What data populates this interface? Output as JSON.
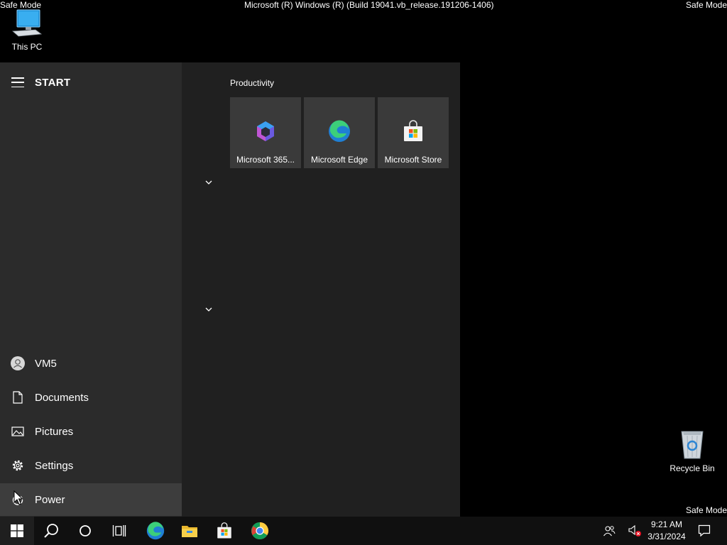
{
  "os_banner": {
    "safe_mode_tl": "Safe Mode",
    "safe_mode_tr": "Safe Mode",
    "safe_mode_br": "Safe Mode",
    "build": "Microsoft (R) Windows (R) (Build 19041.vb_release.191206-1406)"
  },
  "desktop": {
    "this_pc": "This PC",
    "recycle_bin": "Recycle Bin"
  },
  "start_menu": {
    "title": "START",
    "nav": {
      "user": "VM5",
      "documents": "Documents",
      "pictures": "Pictures",
      "settings": "Settings",
      "power": "Power"
    },
    "group_label": "Productivity",
    "tiles": [
      {
        "label": "Microsoft 365...",
        "icon": "microsoft-365-icon"
      },
      {
        "label": "Microsoft Edge",
        "icon": "edge-icon"
      },
      {
        "label": "Microsoft Store",
        "icon": "store-icon"
      }
    ]
  },
  "taskbar": {
    "pinned": [
      "start-icon",
      "search-icon",
      "cortana-icon",
      "task-view-icon",
      "edge-icon",
      "file-explorer-icon",
      "store-icon",
      "chrome-icon"
    ],
    "clock_time": "9:21 AM",
    "clock_date": "3/31/2024"
  },
  "colors": {
    "desktop_bg": "#000000",
    "start_left_bg": "#2b2b2b",
    "start_right_bg": "#202020",
    "tile_bg": "#3a3a3a",
    "taskbar_bg": "#101010"
  }
}
